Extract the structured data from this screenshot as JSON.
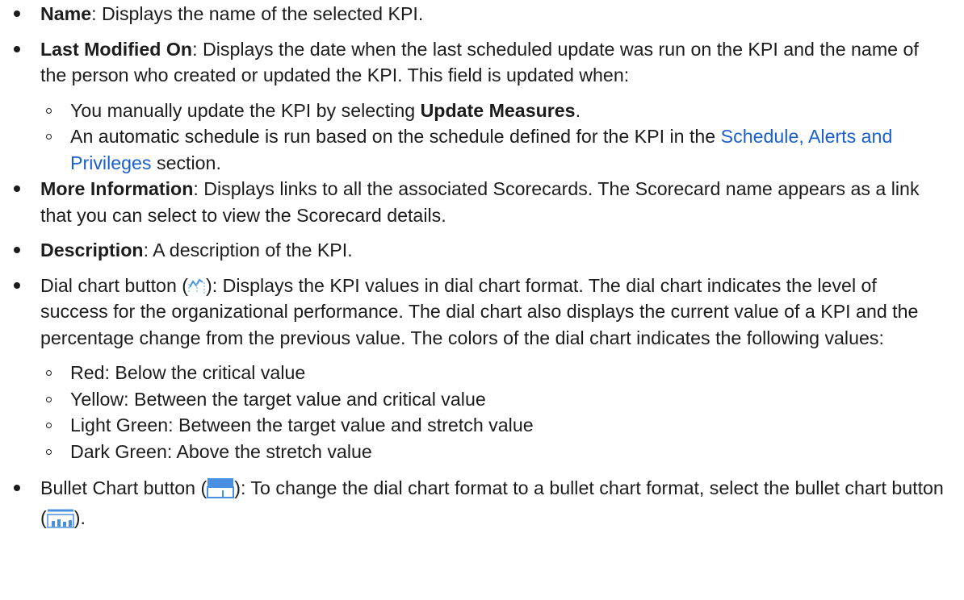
{
  "items": [
    {
      "term": "Name",
      "text": ": Displays the name of the selected KPI."
    },
    {
      "term": "Last Modified On",
      "text": ": Displays the date when the last scheduled update was run on the KPI and the name of the person who created or updated the KPI. This field is updated when:",
      "sub": [
        {
          "pre": "You manually update the KPI by selecting ",
          "bold": "Update Measures",
          "post": "."
        },
        {
          "pre": "An automatic schedule is run based on the schedule defined for the KPI in the ",
          "link": "Schedule, Alerts and Privileges",
          "post": " section."
        }
      ]
    },
    {
      "term": "More Information",
      "text": ": Displays links to all the associated Scorecards. The Scorecard name appears as a link that you can select to view the Scorecard details."
    },
    {
      "term": "Description",
      "text": ": A description of the KPI."
    },
    {
      "pre": "Dial chart button (",
      "post": "): Displays the KPI values in dial chart format. The dial chart indicates the level of success for the organizational performance. The dial chart also displays the current value of a KPI and the percentage change from the previous value. The colors of the dial chart indicates the following values:",
      "colors": [
        "Red: Below the critical value",
        "Yellow: Between the target value and critical value",
        "Light Green: Between the target value and stretch value",
        "Dark Green: Above the stretch value"
      ]
    },
    {
      "pre": "Bullet Chart button (",
      "mid": "): To change the dial chart format to a bullet chart format, select the bullet chart button (",
      "post": ")."
    }
  ],
  "link_color": "#1a5fd1",
  "icon_color": "#4a90e2",
  "icons": [
    "dial-chart-icon",
    "bullet-chart-icon"
  ]
}
